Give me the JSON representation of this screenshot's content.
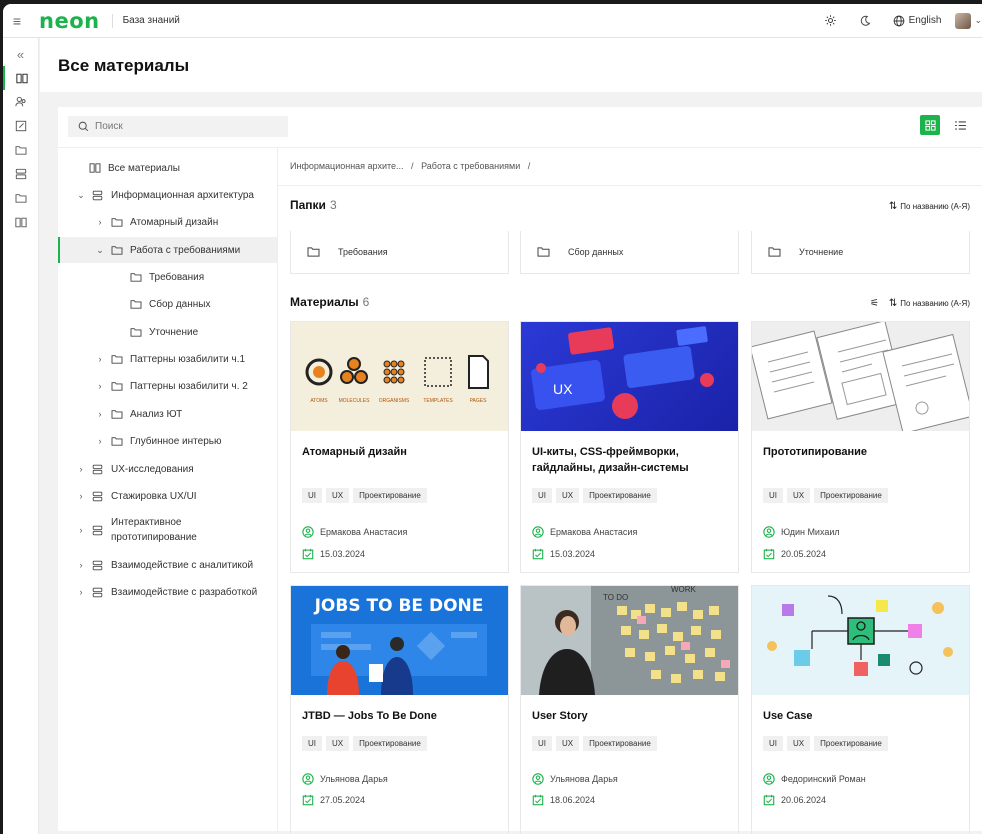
{
  "header": {
    "logo": "neon",
    "section": "База знаний",
    "language": "English"
  },
  "page": {
    "title": "Все материалы"
  },
  "search": {
    "placeholder": "Поиск"
  },
  "tree": [
    {
      "label": "Все материалы",
      "level": 0
    },
    {
      "label": "Информационная архитектура",
      "level": 0
    },
    {
      "label": "Атомарный дизайн",
      "level": 1
    },
    {
      "label": "Работа с требованиями",
      "level": 1
    },
    {
      "label": "Требования",
      "level": 2
    },
    {
      "label": "Сбор данных",
      "level": 2
    },
    {
      "label": "Уточнение",
      "level": 2
    },
    {
      "label": "Паттерны юзабилити ч.1",
      "level": 1
    },
    {
      "label": "Паттерны юзабилити ч. 2",
      "level": 1
    },
    {
      "label": "Анализ ЮТ",
      "level": 1
    },
    {
      "label": "Глубинное интерью",
      "level": 1
    },
    {
      "label": "UX-исследования",
      "level": 0
    },
    {
      "label": "Стажировка UX/UI",
      "level": 0
    },
    {
      "label": "Интерактивное прототипирование",
      "level": 0
    },
    {
      "label": "Взаимодействие с аналитикой",
      "level": 0
    },
    {
      "label": "Взаимодействие с разработкой",
      "level": 0
    }
  ],
  "breadcrumb": {
    "part1": "Информационная архите...",
    "sep": "/",
    "part2": "Работа с требованиями",
    "sep2": "/"
  },
  "folders_section": {
    "title": "Папки",
    "count": "3",
    "sort": "По названию (А-Я)"
  },
  "folders": [
    "Требования",
    "Сбор данных",
    "Уточнение"
  ],
  "materials_section": {
    "title": "Материалы",
    "count": "6",
    "sort": "По названию (А-Я)"
  },
  "materials": [
    {
      "title": "Атомарный дизайн",
      "tags": [
        "UI",
        "UX",
        "Проектирование"
      ],
      "author": "Ермакова Анастасия",
      "date": "15.03.2024"
    },
    {
      "title": "UI-киты, CSS-фреймворки, гайдлайны, дизайн-системы",
      "tags": [
        "UI",
        "UX",
        "Проектирование"
      ],
      "author": "Ермакова Анастасия",
      "date": "15.03.2024"
    },
    {
      "title": "Прототипирование",
      "tags": [
        "UI",
        "UX",
        "Проектирование"
      ],
      "author": "Юдин Михаил",
      "date": "20.05.2024"
    },
    {
      "title": "JTBD — Jobs To Be Done",
      "tags": [
        "UI",
        "UX",
        "Проектирование"
      ],
      "author": "Ульянова Дарья",
      "date": "27.05.2024"
    },
    {
      "title": "User Story",
      "tags": [
        "UI",
        "UX",
        "Проектирование"
      ],
      "author": "Ульянова Дарья",
      "date": "18.06.2024"
    },
    {
      "title": "Use Case",
      "tags": [
        "UI",
        "UX",
        "Проектирование"
      ],
      "author": "Федоринский Роман",
      "date": "20.06.2024"
    }
  ],
  "images": {
    "atoms_labels": [
      "ATOMS",
      "MOLECULES",
      "ORGANISMS",
      "TEMPLATES",
      "PAGES"
    ],
    "jtbd_banner": "JOBS TO BE DONE",
    "ux_label": "UX",
    "todo_label": "TO DO",
    "work_label": "WORK"
  },
  "colors": {
    "accent": "#1cb24c",
    "jtbd_bg": "#1a73d9",
    "ui_bg": "#1d2bb8"
  }
}
